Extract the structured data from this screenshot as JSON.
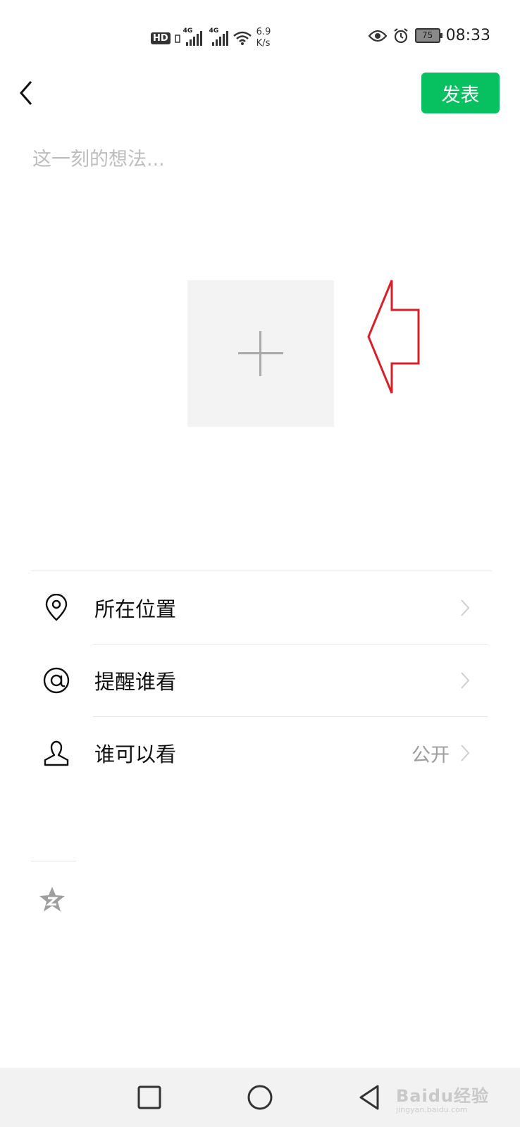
{
  "status_bar": {
    "hd": "HD",
    "sim1": "4G",
    "sim2": "4G",
    "speed_value": "6.9",
    "speed_unit": "K/s",
    "battery": "75",
    "time": "08:33"
  },
  "header": {
    "publish_label": "发表"
  },
  "composer": {
    "placeholder": "这一刻的想法..."
  },
  "settings": {
    "location_label": "所在位置",
    "mention_label": "提醒谁看",
    "visibility_label": "谁可以看",
    "visibility_value": "公开"
  },
  "watermark": {
    "brand": "Baidu经验",
    "url": "jingyan.baidu.com"
  },
  "colors": {
    "accent": "#07c160",
    "annotation_arrow": "#d8202a"
  },
  "icons": {
    "back": "chevron-left-icon",
    "add": "plus-icon",
    "location": "location-pin-icon",
    "mention": "at-sign-icon",
    "visibility": "person-icon",
    "qzone": "qzone-star-icon"
  }
}
